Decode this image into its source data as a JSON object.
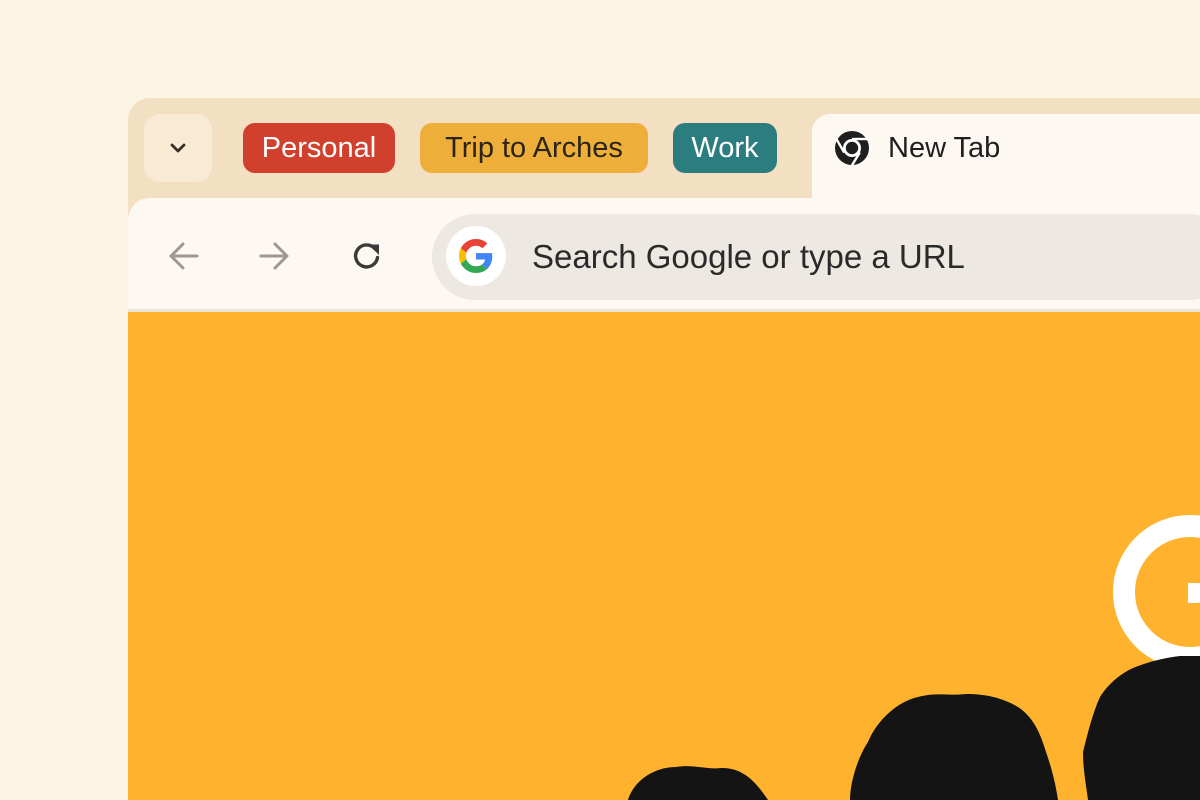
{
  "tab_strip": {
    "tab_search_icon": "chevron-down-icon",
    "groups": [
      {
        "label": "Personal",
        "bg": "#d0402c",
        "fg": "#ffffff"
      },
      {
        "label": "Trip to Arches",
        "bg": "#eeae3a",
        "fg": "#2b2418"
      },
      {
        "label": "Work",
        "bg": "#2c7d80",
        "fg": "#ffffff"
      }
    ],
    "active_tab": {
      "title": "New Tab",
      "icon": "chrome-icon"
    }
  },
  "toolbar": {
    "back_icon": "arrow-left-icon",
    "forward_icon": "arrow-right-icon",
    "reload_icon": "reload-icon",
    "omnibox": {
      "icon": "google-g-icon",
      "placeholder": "Search Google or type a URL"
    }
  },
  "colors": {
    "page_background": "#fdf5e3",
    "tab_strip": "#f3dfc2",
    "toolbar": "#fdf8f2",
    "omnibox": "#ede8e2",
    "content": "#feb22d",
    "doodle_shapes": "#141414"
  }
}
